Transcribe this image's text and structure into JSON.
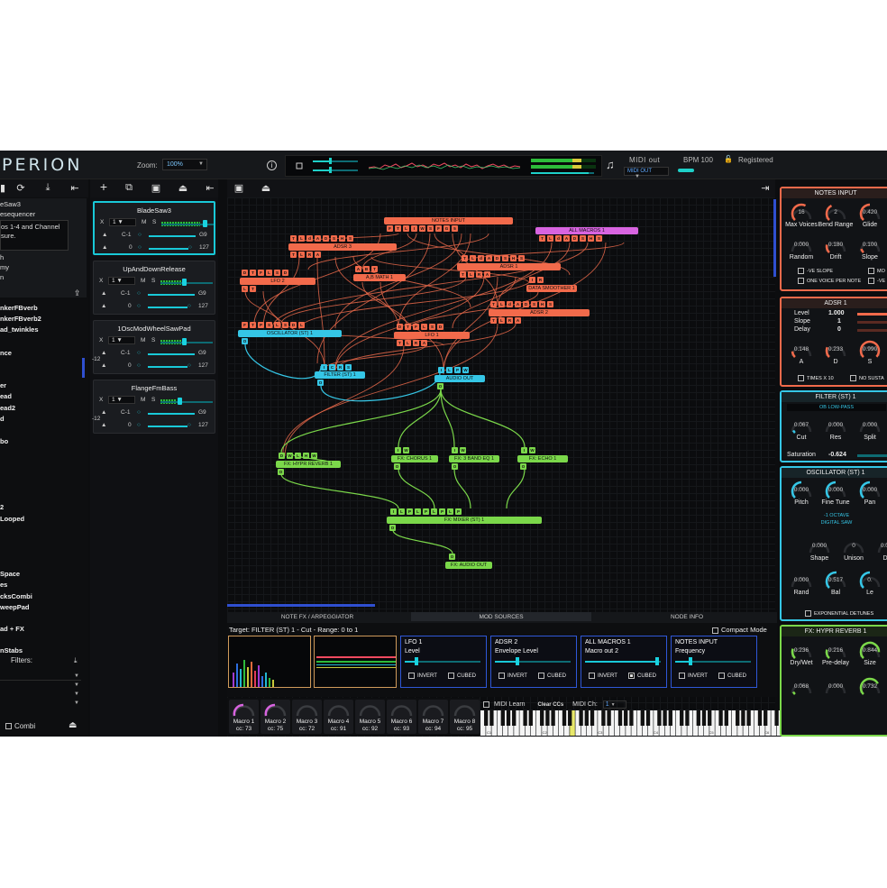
{
  "app": {
    "logo": "PERION",
    "zoom_label": "Zoom:",
    "zoom_value": "100%",
    "midi_out_label": "MIDI out",
    "midi_out_select": "MIDI OUT",
    "bpm": "BPM 100",
    "registered": "Registered",
    "accent": "#19c9d8"
  },
  "browser": {
    "desc_lines": [
      "eSaw3",
      "esequencer",
      "os 1-4 and Channel",
      "sure.",
      "h",
      "my",
      "n"
    ],
    "presets": [
      "nkerFBverb",
      "nkerFBverb2",
      "ad_twinkles",
      "nce",
      "er",
      "ead",
      "ead2",
      "d",
      "bo",
      "2",
      "Looped",
      "Space",
      "es",
      "cksCombi",
      "weepPad",
      "ad + FX",
      "nStabs"
    ],
    "filters_label": "Filters:",
    "combi_label": "Combi"
  },
  "layers": [
    {
      "name": "BladeSaw3",
      "ch": "1",
      "note_low": "C-1",
      "note_high": "G9",
      "vel_low": "0",
      "vel_high": "127",
      "transpose": "",
      "level": 0.85
    },
    {
      "name": "UpAndDownRelease",
      "ch": "1",
      "note_low": "C-1",
      "note_high": "G9",
      "vel_low": "0",
      "vel_high": "127",
      "transpose": "",
      "level": 0.45
    },
    {
      "name": "1OscModWheelSawPad",
      "ch": "1",
      "note_low": "C-1",
      "note_high": "G9",
      "vel_low": "0",
      "vel_high": "127",
      "transpose": "-12",
      "level": 0.45
    },
    {
      "name": "FlangeFmBass",
      "ch": "1",
      "note_low": "C-1",
      "note_high": "G9",
      "vel_low": "0",
      "vel_high": "127",
      "transpose": "-12",
      "level": 0.35
    }
  ],
  "layer_labels": {
    "x": "X",
    "m": "M",
    "s": "S"
  },
  "nodes": {
    "notes_input": "NOTES INPUT",
    "all_macros": "ALL MACROS 1",
    "adsr3": "ADSR 3",
    "adsr1": "ADSR 1",
    "adsr2": "ADSR 2",
    "lfo2": "LFO 2",
    "lfo1": "LFO 1",
    "ab_math": "A,B MATH 1",
    "data_smoother": "DATA SMOOTHER 1",
    "oscillator": "OSCILLATOR (ST) 1",
    "filter": "FILTER (ST) 1",
    "audio_out": "AUDIO OUT",
    "fx_reverb": "FX: HYPR REVERB 1",
    "fx_chorus": "FX: CHORUS 1",
    "fx_eq": "FX: 3 BAND EQ 1",
    "fx_echo": "FX: ECHO 1",
    "fx_mixer": "FX: MIXER (ST) 1",
    "fx_audio_out": "FX: AUDIO OUT"
  },
  "bottom": {
    "tabs": [
      "NOTE FX / ARPEGGIATOR",
      "MOD SOURCES",
      "NODE INFO"
    ],
    "target": "Target: FILTER (ST) 1 - Cut - Range: 0 to 1",
    "compact_mode": "Compact Mode",
    "mod_sources": [
      {
        "title": "LFO 1",
        "sub": "Level",
        "invert": "INVERT",
        "cubed": "CUBED",
        "amount": 0.15,
        "cubed_checked": false
      },
      {
        "title": "ADSR 2",
        "sub": "Envelope Level",
        "invert": "INVERT",
        "cubed": "CUBED",
        "amount": 0.3,
        "cubed_checked": false
      },
      {
        "title": "ALL MACROS 1",
        "sub": "Macro out 2",
        "invert": "INVERT",
        "cubed": "CUBED",
        "amount": 0.95,
        "cubed_checked": true
      },
      {
        "title": "NOTES INPUT",
        "sub": "Frequency",
        "invert": "INVERT",
        "cubed": "CUBED",
        "amount": 0.2,
        "cubed_checked": false
      }
    ]
  },
  "macros": [
    {
      "name": "Macro 1",
      "cc": "cc: 73"
    },
    {
      "name": "Macro 2",
      "cc": "cc: 75"
    },
    {
      "name": "Macro 3",
      "cc": "cc: 72"
    },
    {
      "name": "Macro 4",
      "cc": "cc: 91"
    },
    {
      "name": "Macro 5",
      "cc": "cc: 92"
    },
    {
      "name": "Macro 6",
      "cc": "cc: 93"
    },
    {
      "name": "Macro 7",
      "cc": "cc: 94"
    },
    {
      "name": "Macro 8",
      "cc": "cc: 95"
    }
  ],
  "midi": {
    "learn": "MIDI Learn",
    "clear": "Clear CCs",
    "channel_label": "MIDI Ch:",
    "channel": "1"
  },
  "keyboard": {
    "octaves": [
      "C1",
      "C2",
      "C3",
      "C4",
      "C5",
      "C6",
      "C7"
    ]
  },
  "inspector": {
    "notes_input": {
      "title": "NOTES INPUT",
      "knobs": [
        {
          "value": "16",
          "label": "Max Voices"
        },
        {
          "value": "2",
          "label": "Bend Range"
        },
        {
          "value": "0.420",
          "label": "Glide"
        },
        {
          "value": "0.000",
          "label": "Random"
        },
        {
          "value": "0.180",
          "label": "Drift"
        },
        {
          "value": "0.100",
          "label": "Slope"
        }
      ],
      "opt1": "-VE SLOPE",
      "opt2": "ONE VOICE PER NOTE",
      "opt3": "MO",
      "opt4": "-VE"
    },
    "adsr": {
      "title": "ADSR 1",
      "level_label": "Level",
      "level": "1.000",
      "slope_label": "Slope",
      "slope": "1",
      "delay_label": "Delay",
      "delay": "0",
      "knobs": [
        {
          "value": "0.148",
          "label": "A"
        },
        {
          "value": "0.233",
          "label": "D"
        },
        {
          "value": "0.990",
          "label": "S"
        }
      ],
      "opt1": "TIMES X 10",
      "opt2": "NO SUSTA"
    },
    "filter": {
      "title": "FILTER (ST) 1",
      "type": "OB LOW-PASS",
      "knobs": [
        {
          "value": "0.067",
          "label": "Cut"
        },
        {
          "value": "0.000",
          "label": "Res"
        },
        {
          "value": "0.000",
          "label": "Split"
        }
      ],
      "saturation_label": "Saturation",
      "saturation": "-0.624"
    },
    "oscillator": {
      "title": "OSCILLATOR (ST) 1",
      "knobs": [
        {
          "value": "0.000",
          "label": "Pitch"
        },
        {
          "value": "0.000",
          "label": "Fine Tune"
        },
        {
          "value": "0.000",
          "label": "Pan"
        }
      ],
      "octave": "-1 OCTAVE",
      "wave": "DIGITAL SAW",
      "knobs2": [
        {
          "value": "0.000",
          "label": "Shape"
        },
        {
          "value": "0",
          "label": "Unison"
        },
        {
          "value": "0.000",
          "label": "Det"
        }
      ],
      "knobs3": [
        {
          "value": "0.000",
          "label": "Rand"
        },
        {
          "value": "0.517",
          "label": "Bal"
        },
        {
          "value": "0.",
          "label": "Le"
        }
      ],
      "opt": "EXPONENTIAL DETUNES"
    },
    "reverb": {
      "title": "FX: HYPR REVERB 1",
      "knobs": [
        {
          "value": "0.236",
          "label": "Dry/Wet"
        },
        {
          "value": "0.216",
          "label": "Pre-delay"
        },
        {
          "value": "0.844",
          "label": "Size"
        }
      ],
      "knobs2": [
        {
          "value": "0.068",
          "label": ""
        },
        {
          "value": "0.000",
          "label": ""
        },
        {
          "value": "0.732",
          "label": ""
        }
      ]
    }
  }
}
